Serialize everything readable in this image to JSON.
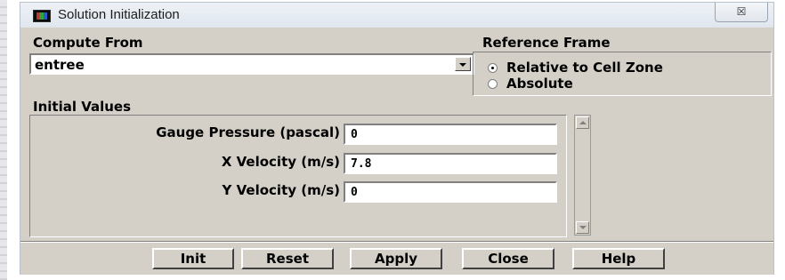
{
  "window": {
    "title": "Solution Initialization",
    "close_glyph": "☒"
  },
  "compute_from": {
    "label": "Compute From",
    "selected": "entree"
  },
  "reference_frame": {
    "label": "Reference Frame",
    "options": [
      {
        "label": "Relative to Cell Zone",
        "selected": true
      },
      {
        "label": "Absolute",
        "selected": false
      }
    ]
  },
  "initial_values": {
    "label": "Initial Values",
    "rows": [
      {
        "label": "Gauge Pressure (pascal)",
        "value": "0"
      },
      {
        "label": "X Velocity (m/s)",
        "value": "7.8"
      },
      {
        "label": "Y Velocity (m/s)",
        "value": "0"
      }
    ]
  },
  "buttons": {
    "init": "Init",
    "reset": "Reset",
    "apply": "Apply",
    "close": "Close",
    "help": "Help"
  }
}
